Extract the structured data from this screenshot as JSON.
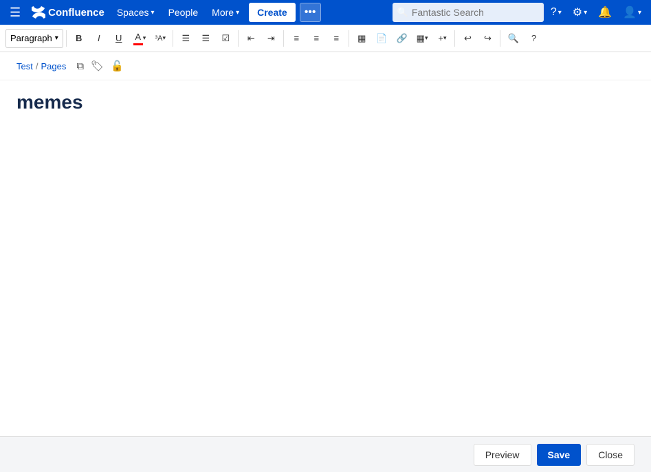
{
  "nav": {
    "logo_text": "Confluence",
    "spaces_label": "Spaces",
    "people_label": "People",
    "more_label": "More",
    "create_label": "Create",
    "search_placeholder": "Fantastic Search",
    "help_label": "?",
    "settings_label": "⚙",
    "notifications_label": "🔔",
    "profile_label": "👤"
  },
  "toolbar": {
    "paragraph_label": "Paragraph",
    "bold_label": "B",
    "italic_label": "I",
    "underline_label": "U",
    "color_label": "A",
    "font_size_label": "³A",
    "bullet_label": "≡",
    "number_label": "≡",
    "check_label": "✓",
    "outdent_label": "←",
    "indent_label": "→",
    "align_left_label": "≡",
    "align_center_label": "≡",
    "align_right_label": "≡",
    "table_label": "▦",
    "insert_label": "+",
    "undo_label": "↩",
    "redo_label": "↪",
    "search_label": "🔍",
    "help_label": "?"
  },
  "breadcrumb": {
    "parent": "Test",
    "separator": "/",
    "current": "Pages"
  },
  "page": {
    "title": "memes",
    "content": ""
  },
  "footer": {
    "preview_label": "Preview",
    "save_label": "Save",
    "close_label": "Close"
  }
}
